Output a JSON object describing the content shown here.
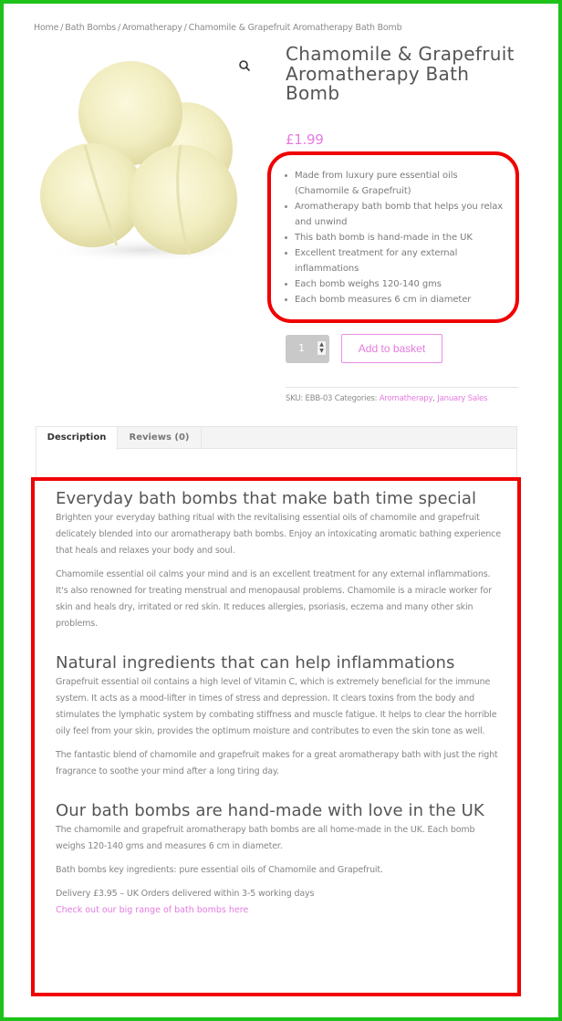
{
  "breadcrumb": [
    "Home",
    "Bath Bombs",
    "Aromatherapy",
    "Chamomile & Grapefruit Aromatherapy Bath Bomb"
  ],
  "breadcrumb_separator": "/",
  "product": {
    "title": "Chamomile & Grapefruit Aromatherapy Bath Bomb",
    "price": "£1.99",
    "image_alt": "Three pale yellow bath bombs",
    "zoom_icon": "magnifier-icon",
    "features": [
      "Made from luxury pure essential oils (Chamomile & Grapefruit)",
      "Aromatherapy bath bomb that helps you relax and unwind",
      "This bath bomb is hand-made in the UK",
      "Excellent treatment for any external inflammations",
      "Each bomb weighs 120-140 gms",
      "Each bomb measures 6 cm in diameter"
    ],
    "quantity": "1",
    "add_to_basket_label": "Add to basket",
    "sku_label": "SKU:",
    "sku": "EBB-03",
    "categories_label": "Categories:",
    "categories": [
      "Aromatherapy",
      "January Sales"
    ]
  },
  "tabs": [
    {
      "label": "Description",
      "active": true
    },
    {
      "label": "Reviews (0)",
      "active": false
    }
  ],
  "description": {
    "sections": [
      {
        "heading": "Everyday bath bombs that make bath time special",
        "paragraphs": [
          "Brighten your everyday bathing ritual with the revitalising essential oils of chamomile and grapefruit delicately blended into our aromatherapy bath bombs. Enjoy an intoxicating aromatic bathing experience that heals and relaxes your body and soul.",
          "Chamomile essential oil calms your mind and is an excellent treatment for any external inflammations. It's also renowned for treating menstrual and menopausal problems. Chamomile is a miracle worker for skin and heals dry, irritated or red skin. It reduces allergies, psoriasis, eczema and many other skin problems."
        ]
      },
      {
        "heading": "Natural ingredients that can help inflammations",
        "paragraphs": [
          "Grapefruit essential oil contains a high level of Vitamin C, which is extremely beneficial for the immune system. It acts as a mood-lifter in times of stress and depression. It clears toxins from the body and stimulates the lymphatic system by combating stiffness and muscle fatigue. It helps to clear the horrible oily feel from your skin, provides the optimum moisture and contributes to even the skin tone as well.",
          "The fantastic blend of chamomile and grapefruit makes for a great aromatherapy bath with just the right fragrance to soothe your mind after a long tiring day."
        ]
      },
      {
        "heading": "Our bath bombs are hand-made with love in the UK",
        "paragraphs": [
          "The chamomile and grapefruit aromatherapy bath bombs are all home-made in the UK. Each bomb weighs 120-140 gms and measures 6 cm in diameter.",
          "Bath bombs key ingredients: pure essential oils of Chamomile and Grapefruit.",
          "Delivery £3.95 – UK Orders delivered within 3-5 working days"
        ],
        "link": "Check out our big range of bath bombs here"
      }
    ]
  },
  "colors": {
    "accent": "#e57ae0",
    "highlight_border": "#f00000",
    "frame": "#1ec31a"
  }
}
